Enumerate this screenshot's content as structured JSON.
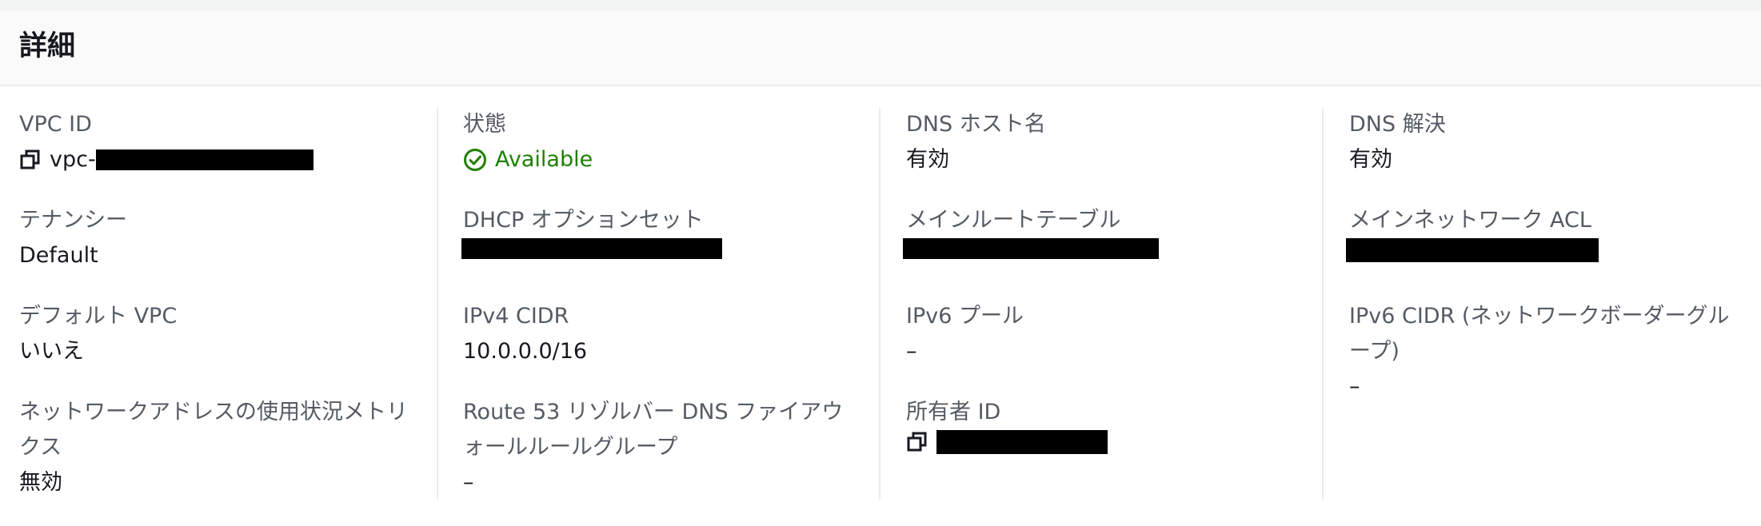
{
  "panel": {
    "title": "詳細"
  },
  "fields": {
    "vpc_id": {
      "label": "VPC ID",
      "value_prefix": "vpc-"
    },
    "tenancy": {
      "label": "テナンシー",
      "value": "Default"
    },
    "default_vpc": {
      "label": "デフォルト VPC",
      "value": "いいえ"
    },
    "network_usage_metrics": {
      "label": "ネットワークアドレスの使用状況メトリクス",
      "value": "無効"
    },
    "state": {
      "label": "状態",
      "value": "Available"
    },
    "dhcp_options": {
      "label": "DHCP オプションセット"
    },
    "ipv4_cidr": {
      "label": "IPv4 CIDR",
      "value": "10.0.0.0/16"
    },
    "route53_firewall": {
      "label": "Route 53 リゾルバー DNS ファイアウォールルールグループ",
      "value": "–"
    },
    "dns_hostnames": {
      "label": "DNS ホスト名",
      "value": "有効"
    },
    "main_route_table": {
      "label": "メインルートテーブル"
    },
    "ipv6_pool": {
      "label": "IPv6 プール",
      "value": "–"
    },
    "owner_id": {
      "label": "所有者 ID"
    },
    "dns_resolution": {
      "label": "DNS 解決",
      "value": "有効"
    },
    "main_network_acl": {
      "label": "メインネットワーク ACL"
    },
    "ipv6_cidr_border_group": {
      "label": "IPv6 CIDR (ネットワークボーダーグループ)",
      "value": "–"
    }
  },
  "colors": {
    "status_available": "#1d8102",
    "label": "#545b64",
    "text": "#16191f"
  },
  "icons": {
    "copy": "copy-icon",
    "status": "status-check-icon"
  }
}
